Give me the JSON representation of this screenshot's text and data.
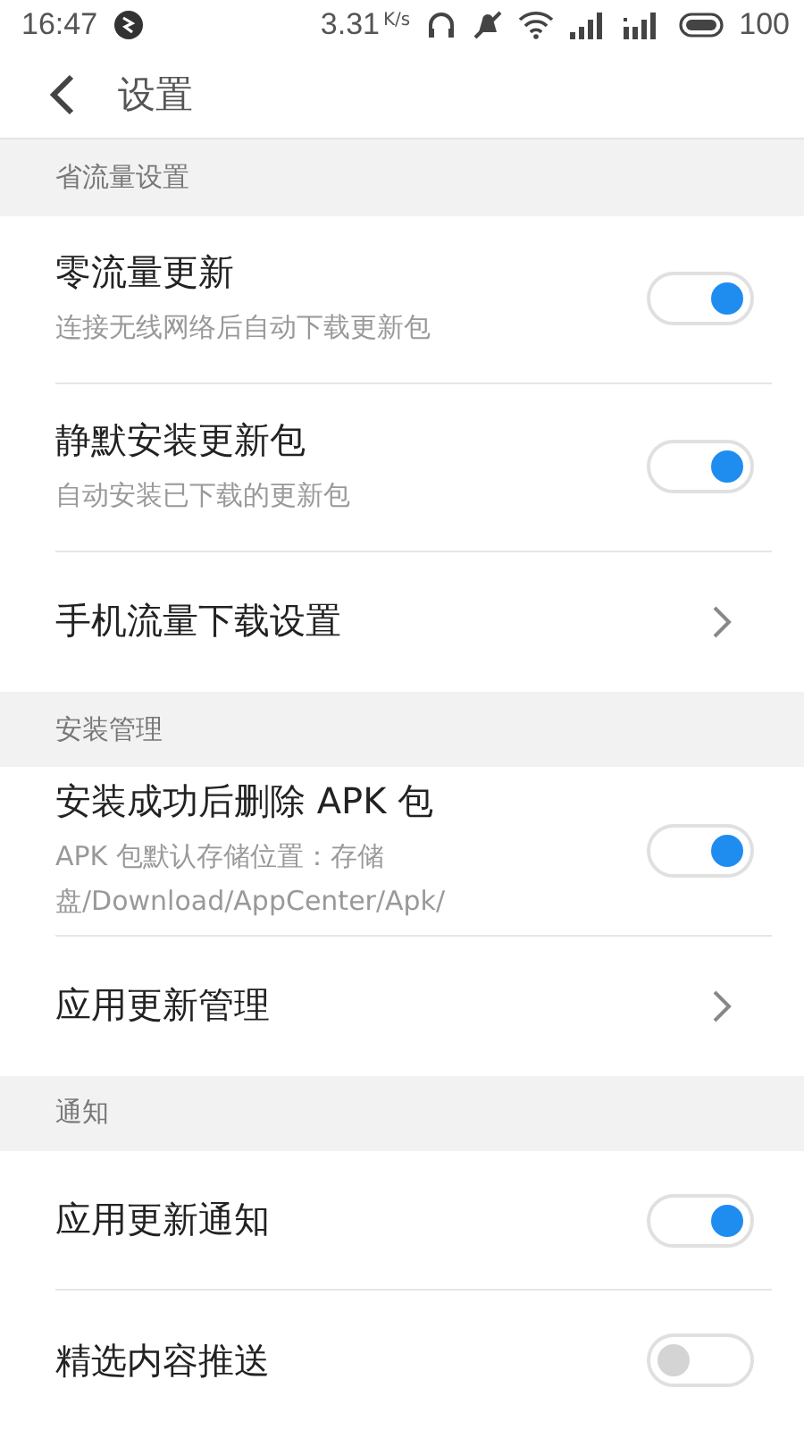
{
  "status_bar": {
    "time": "16:47",
    "speed": "3.31",
    "speed_unit": "K/s",
    "battery": "100"
  },
  "header": {
    "title": "设置"
  },
  "sections": [
    {
      "title": "省流量设置",
      "items": [
        {
          "kind": "toggle",
          "title": "零流量更新",
          "subtitle": "连接无线网络后自动下载更新包",
          "on": true
        },
        {
          "kind": "toggle",
          "title": "静默安装更新包",
          "subtitle": "自动安装已下载的更新包",
          "on": true
        },
        {
          "kind": "link",
          "title": "手机流量下载设置"
        }
      ]
    },
    {
      "title": "安装管理",
      "items": [
        {
          "kind": "toggle",
          "title": "安装成功后删除 APK 包",
          "subtitle": "APK 包默认存储位置：存储盘/Download/AppCenter/Apk/",
          "on": true
        },
        {
          "kind": "link",
          "title": "应用更新管理"
        }
      ]
    },
    {
      "title": "通知",
      "items": [
        {
          "kind": "toggle",
          "title": "应用更新通知",
          "on": true
        },
        {
          "kind": "toggle",
          "title": "精选内容推送",
          "on": false
        }
      ]
    }
  ]
}
